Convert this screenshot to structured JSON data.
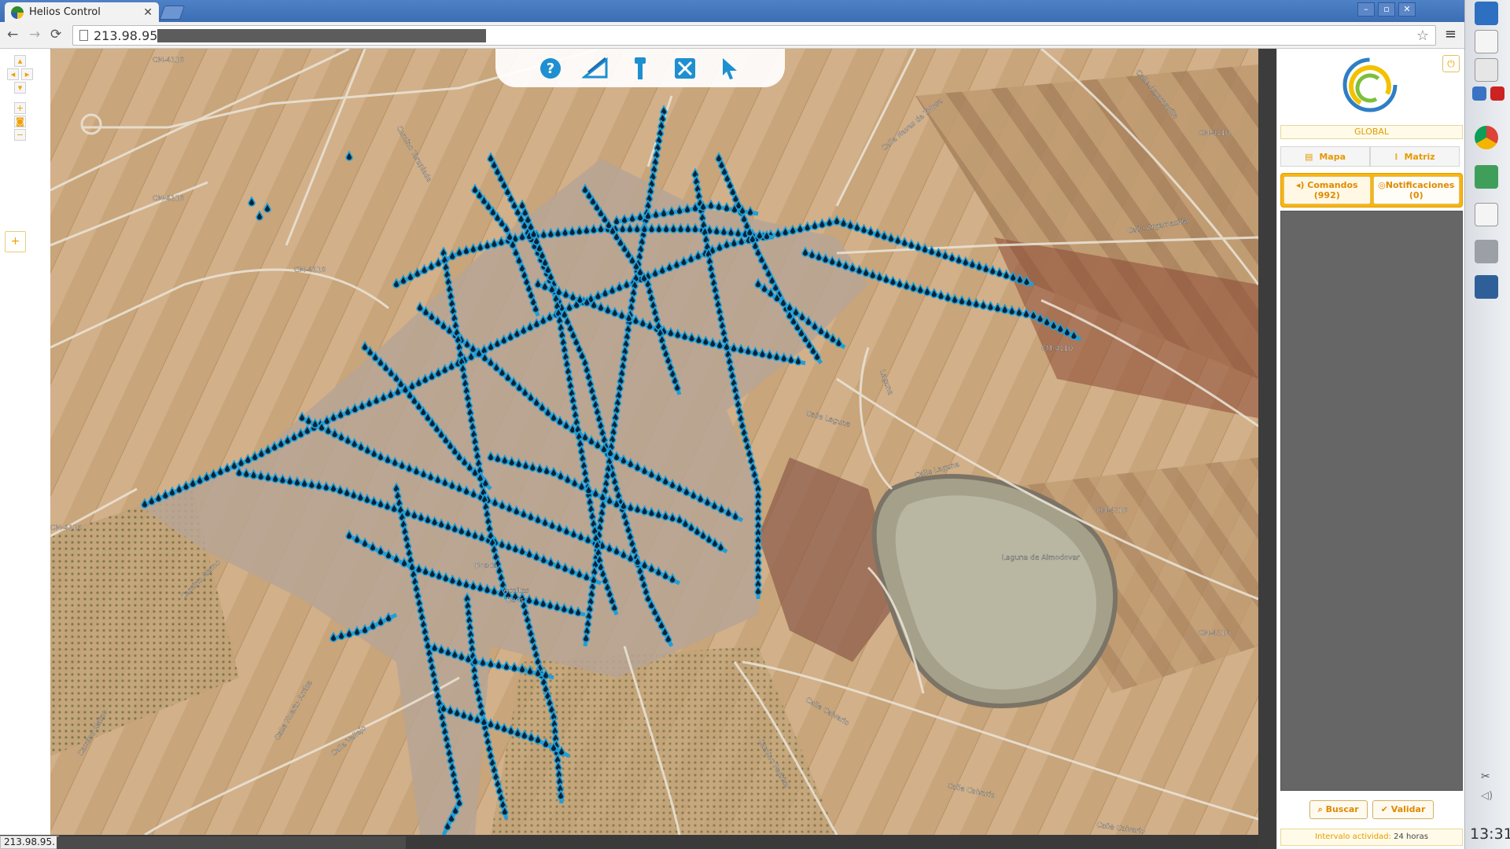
{
  "browser": {
    "tab_title": "Helios Control",
    "tab_close": "✕",
    "url": "213.98.95.",
    "status_url": "213.98.95.",
    "window_controls": [
      "–",
      "▫",
      "✕"
    ]
  },
  "map": {
    "type": "satellite",
    "road_labels": [
      "CM-4110",
      "CM-4110",
      "CM-4110",
      "CM-4110",
      "CM-4110",
      "CM-4110",
      "CM-4110",
      "CM-4115",
      "Calle Laguna",
      "Calle Laguna",
      "Calle Calvario",
      "Calle Calvario",
      "Calle Calvario",
      "Calle Argamasilla",
      "Calle Argamasilla",
      "Calle Navas de Tolosa",
      "Camino Taraplada",
      "Camino Alamo",
      "Camino Alamo",
      "Calle Huerto Arriba",
      "Calle Vallejo",
      "Camino Pedriza",
      "Aceites",
      "Baos",
      "Boada",
      "Laguna de Almodovar",
      "Laguna"
    ],
    "marker_color": "#1e9fd8"
  },
  "toolbar": {
    "tools": [
      "help-icon",
      "measure-icon",
      "street-light-icon",
      "tools-icon",
      "pointer-icon"
    ]
  },
  "panel": {
    "scope": "GLOBAL",
    "tab_map": "Mapa",
    "tab_matrix": "Matriz",
    "commands_label": "Comandos",
    "commands_count": "(992)",
    "notifications_label": "Notificaciones",
    "notifications_count": "(0)",
    "search_button": "Buscar",
    "validate_button": "Validar",
    "interval_label": "Intervalo actividad:",
    "interval_value": "24 horas",
    "accent": "#f7b50f"
  },
  "system": {
    "clock": "13:31"
  }
}
